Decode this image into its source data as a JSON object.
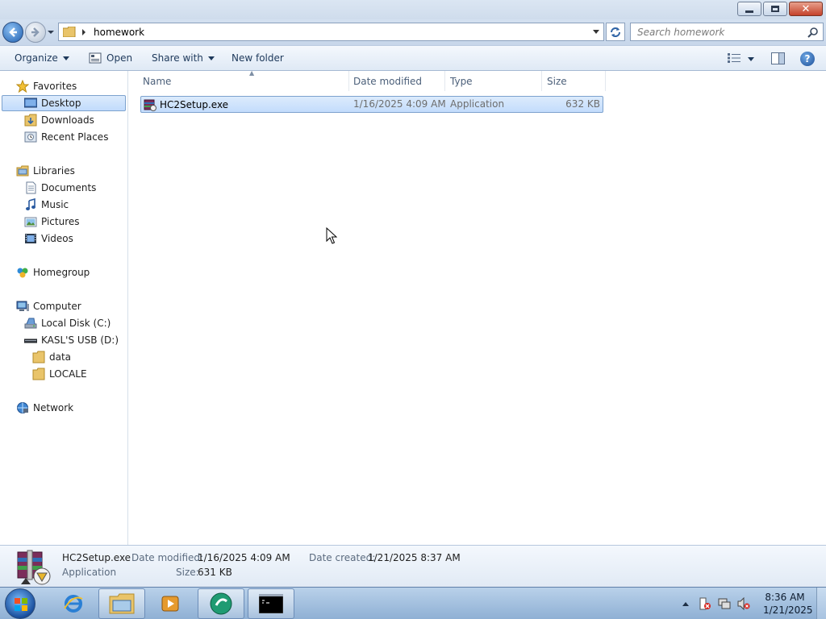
{
  "address": {
    "path": "homework"
  },
  "search": {
    "placeholder": "Search homework"
  },
  "toolbar": {
    "organize": "Organize",
    "open": "Open",
    "share_with": "Share with",
    "new_folder": "New folder"
  },
  "nav": {
    "favorites": "Favorites",
    "desktop": "Desktop",
    "downloads": "Downloads",
    "recent": "Recent Places",
    "libraries": "Libraries",
    "documents": "Documents",
    "music": "Music",
    "pictures": "Pictures",
    "videos": "Videos",
    "homegroup": "Homegroup",
    "computer": "Computer",
    "local_disk": "Local Disk (C:)",
    "usb": "KASL'S USB (D:)",
    "data": "data",
    "locale": "LOCALE",
    "network": "Network"
  },
  "columns": {
    "name": "Name",
    "date_modified": "Date modified",
    "type": "Type",
    "size": "Size"
  },
  "files": [
    {
      "name": "HC2Setup.exe",
      "date_modified": "1/16/2025 4:09 AM",
      "type": "Application",
      "size": "632 KB"
    }
  ],
  "details": {
    "name": "HC2Setup.exe",
    "type": "Application",
    "date_modified_label": "Date modified:",
    "date_modified": "1/16/2025 4:09 AM",
    "date_created_label": "Date created:",
    "date_created": "1/21/2025 8:37 AM",
    "size_label": "Size:",
    "size": "631 KB"
  },
  "clock": {
    "time": "8:36 AM",
    "date": "1/21/2025"
  }
}
